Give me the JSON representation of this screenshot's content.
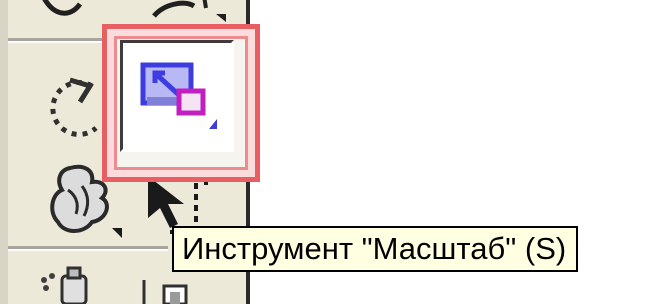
{
  "tooltip": {
    "text": "Инструмент \"Масштаб\" (S)"
  },
  "toolbox": {
    "active_tool": "scale-tool",
    "tools": [
      {
        "name": "partial-tool-top",
        "icon": "partial-tool-icon",
        "active": false
      },
      {
        "name": "rotate-tool",
        "icon": "rotate-dashed-arc-icon",
        "active": false
      },
      {
        "name": "scale-tool",
        "icon": "scale-icon",
        "active": true
      },
      {
        "name": "warp-tool",
        "icon": "warp-hand-icon",
        "active": false
      },
      {
        "name": "free-transform-tool",
        "icon": "arrow-dotted-icon",
        "active": false
      },
      {
        "name": "symbol-sprayer-tool",
        "icon": "sprayer-icon",
        "active": false
      },
      {
        "name": "graph-tool",
        "icon": "graph-icon",
        "active": false
      }
    ]
  },
  "colors": {
    "highlight_border": "#e85f63",
    "highlight_fill": "#fbdbdb",
    "tooltip_background": "#ffffe1",
    "toolbox_background": "#ece9d8",
    "scale_icon_blue": "#3c3ce0",
    "scale_icon_magenta": "#c020c0"
  }
}
